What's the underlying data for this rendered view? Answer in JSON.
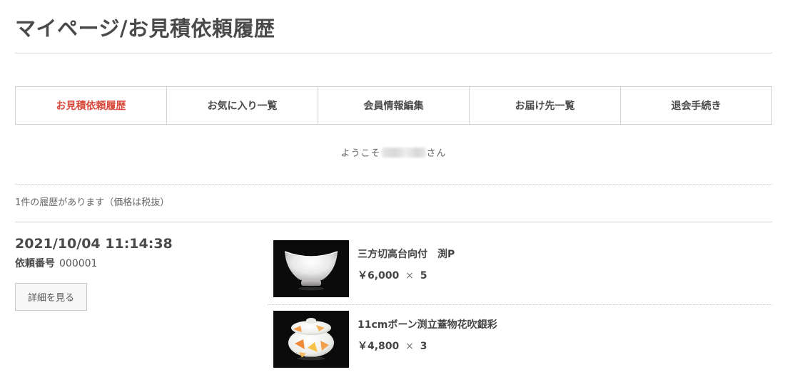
{
  "page": {
    "title": "マイページ/お見積依頼履歴"
  },
  "tabs": [
    {
      "label": "お見積依頼履歴",
      "active": true
    },
    {
      "label": "お気に入り一覧",
      "active": false
    },
    {
      "label": "会員情報編集",
      "active": false
    },
    {
      "label": "お届け先一覧",
      "active": false
    },
    {
      "label": "退会手続き",
      "active": false
    }
  ],
  "welcome": {
    "prefix": "ようこそ",
    "suffix": "さん"
  },
  "history": {
    "count_text": "1件の履歴があります（価格は税抜）"
  },
  "order": {
    "datetime": "2021/10/04 11:14:38",
    "number_label": "依頼番号",
    "number": "000001",
    "detail_button": "詳細を見る",
    "items": [
      {
        "name": "三方切高台向付　渕P",
        "price": "￥6,000",
        "times": "×",
        "quantity": "5"
      },
      {
        "name": "11cmボーン渕立蓋物花吹銀彩",
        "price": "￥4,800",
        "times": "×",
        "quantity": "3"
      }
    ]
  },
  "colors": {
    "active_tab": "#d9483b",
    "text": "#4a4a4a",
    "border": "#d2d2d2"
  }
}
